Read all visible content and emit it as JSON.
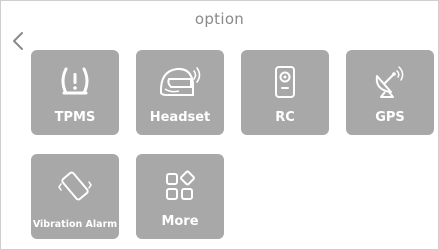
{
  "header": {
    "title": "option",
    "back_icon": "chevron-left-icon"
  },
  "tiles": [
    {
      "label": "TPMS",
      "icon": "tire-pressure-icon"
    },
    {
      "label": "Headset",
      "icon": "helmet-headset-icon"
    },
    {
      "label": "RC",
      "icon": "remote-control-icon"
    },
    {
      "label": "GPS",
      "icon": "satellite-dish-icon"
    },
    {
      "label": "Vibration Alarm",
      "icon": "vibration-icon"
    },
    {
      "label": "More",
      "icon": "more-apps-icon"
    }
  ],
  "colors": {
    "tile_background": "#a8a8a8",
    "tile_text": "#ffffff",
    "title_text": "#8a8a8a",
    "background": "#ffffff"
  }
}
